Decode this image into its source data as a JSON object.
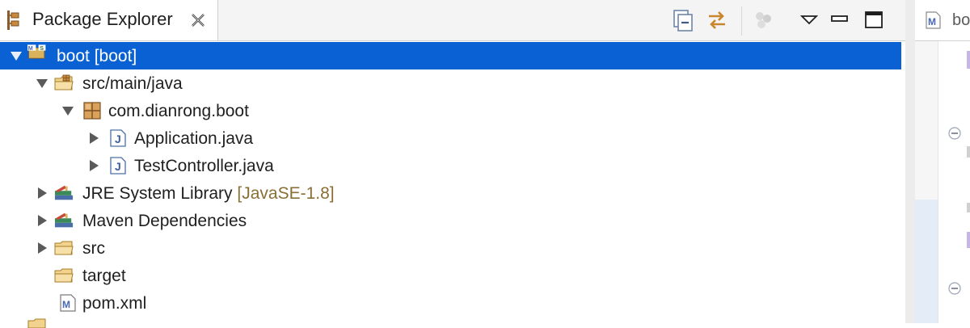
{
  "view": {
    "title": "Package Explorer",
    "icons": {
      "view": "package-explorer-icon",
      "close": "close-icon",
      "collapse_all": "collapse-all-icon",
      "link_with_editor": "link-with-editor-icon",
      "focus": "focus-on-active-task-icon",
      "view_menu": "view-menu-icon",
      "minimize": "minimize-icon",
      "maximize": "maximize-icon"
    }
  },
  "tree": [
    {
      "label": "boot [boot]",
      "expanded": true,
      "selected": true,
      "icon": "maven-project-icon"
    },
    {
      "label": "src/main/java",
      "expanded": true,
      "icon": "source-folder-icon"
    },
    {
      "label": "com.dianrong.boot",
      "expanded": true,
      "icon": "package-icon"
    },
    {
      "label": "Application.java",
      "expanded": false,
      "icon": "java-file-icon"
    },
    {
      "label": "TestController.java",
      "expanded": false,
      "icon": "java-file-icon"
    },
    {
      "label": "JRE System Library",
      "decoration": "[JavaSE-1.8]",
      "expanded": false,
      "icon": "library-icon"
    },
    {
      "label": "Maven Dependencies",
      "expanded": false,
      "icon": "library-icon"
    },
    {
      "label": "src",
      "expanded": false,
      "icon": "folder-icon"
    },
    {
      "label": "target",
      "icon": "folder-icon"
    },
    {
      "label": "pom.xml",
      "icon": "maven-pom-icon"
    }
  ],
  "editor": {
    "tab_label": "bo",
    "tab_icon": "maven-pom-icon"
  },
  "colors": {
    "selection": "#0a61d4",
    "decoration": "#8a6f35"
  }
}
